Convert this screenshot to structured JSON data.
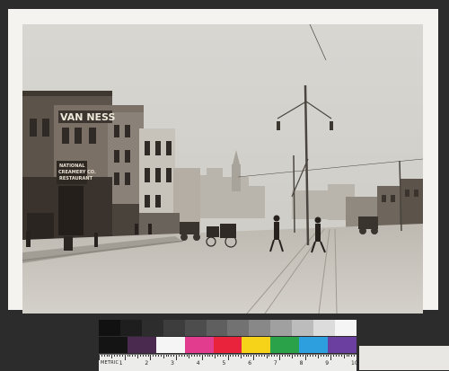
{
  "photo": {
    "signs": {
      "van_ness": "VAN NESS",
      "storefront_line1": "NATIONAL",
      "storefront_line2": "CREAMERY CO.",
      "storefront_line3": "RESTAURANT"
    }
  },
  "color_target": {
    "gray_patches": [
      "#111111",
      "#1e1e1e",
      "#2d2d2d",
      "#3d3d3d",
      "#4d4d4d",
      "#5f5f5f",
      "#727272",
      "#888888",
      "#a0a0a0",
      "#bcbcbc",
      "#dcdcdc",
      "#f5f5f5"
    ],
    "color_patches": [
      "#141414",
      "#4a2a4f",
      "#f5f5f5",
      "#e23c8f",
      "#e8233b",
      "#f6d219",
      "#2aa24a",
      "#2e9fde",
      "#6b3fa0"
    ],
    "ruler": {
      "unit_label": "METRIC",
      "numbers": [
        "1",
        "2",
        "3",
        "4",
        "5",
        "6",
        "7",
        "8",
        "9",
        "10"
      ]
    }
  }
}
